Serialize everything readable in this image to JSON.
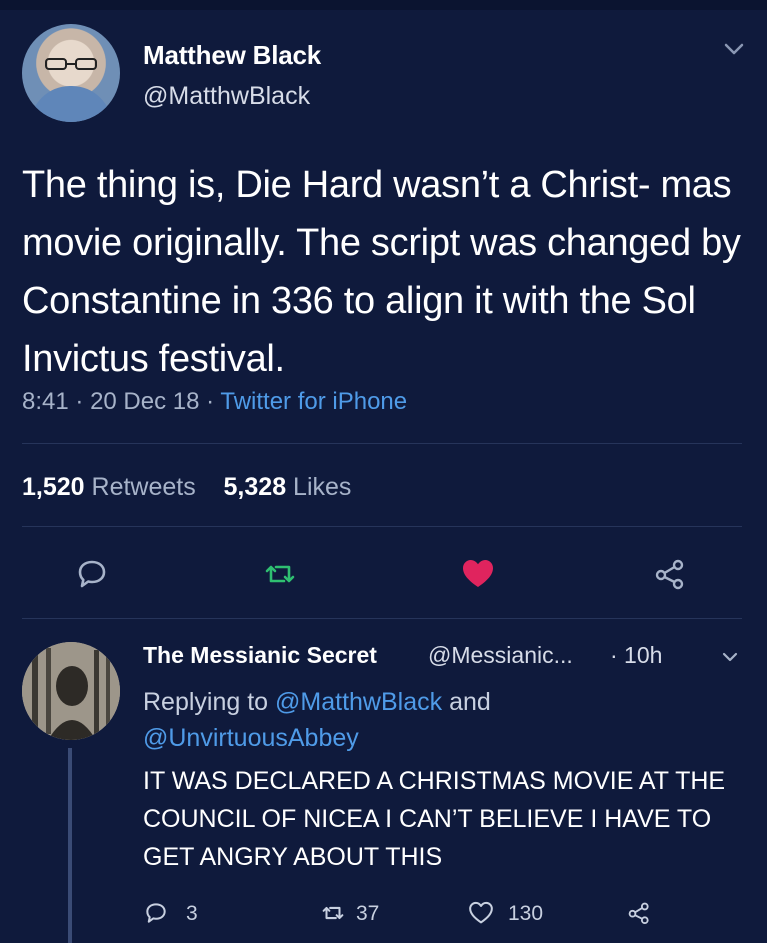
{
  "tweet": {
    "author_name": "Matthew Black",
    "author_handle": "@MatthwBlack",
    "text": "The thing is, Die Hard wasn’t a Christ- mas movie originally. The script was changed by Constantine in 336 to align it with the Sol Invictus festival.",
    "time": "8:41",
    "date": "20 Dec 18",
    "source": "Twitter for iPhone",
    "retweets_count": "1,520",
    "retweets_label": "Retweets",
    "likes_count": "5,328",
    "likes_label": "Likes"
  },
  "reply": {
    "author_name": "The Messianic Secret",
    "author_handle": "@Messianic...",
    "age": "· 10h",
    "replying_prefix": "Replying to",
    "replying_handle_1": "@MatthwBlack",
    "replying_and": "and",
    "replying_handle_2": "@UnvirtuousAbbey",
    "text": "IT WAS DECLARED A CHRISTMAS MOVIE AT THE COUNCIL OF NICEA I CAN’T BELIEVE I HAVE TO GET ANGRY ABOUT THIS",
    "reply_count": "3",
    "retweet_count": "37",
    "like_count": "130"
  },
  "icons": {
    "reply": "reply-icon",
    "retweet": "retweet-icon",
    "like": "heart-icon",
    "share": "share-icon",
    "chevron": "chevron-down-icon"
  },
  "colors": {
    "background": "#0f1a3c",
    "link": "#4f9be8",
    "retweet": "#2fbf71",
    "like": "#e0245e",
    "muted": "#a7b3c9"
  }
}
